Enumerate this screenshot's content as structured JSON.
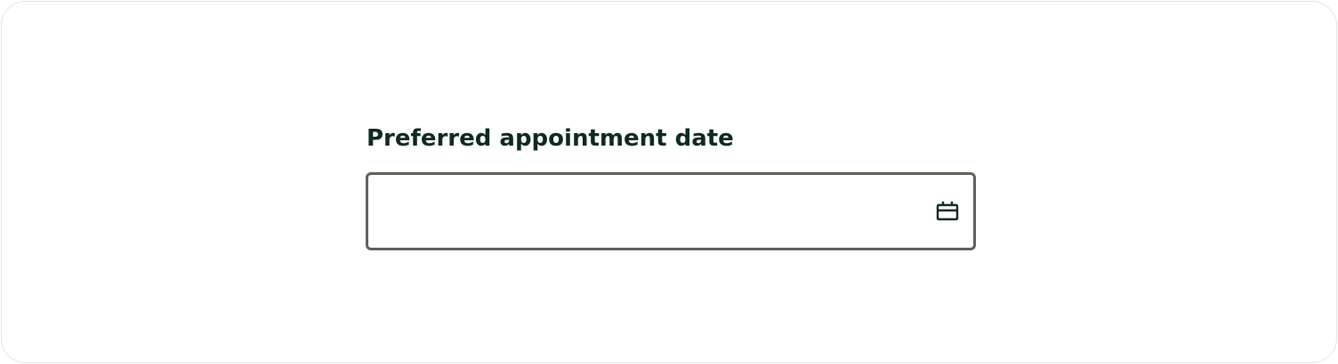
{
  "form": {
    "date_field": {
      "label": "Preferred appointment date",
      "value": "",
      "placeholder": "",
      "icon": "calendar-icon"
    }
  },
  "colors": {
    "label_text": "#0f2a1e",
    "input_border": "#635e59",
    "icon_stroke": "#0f2a1e",
    "card_border": "#e3e3e3"
  }
}
